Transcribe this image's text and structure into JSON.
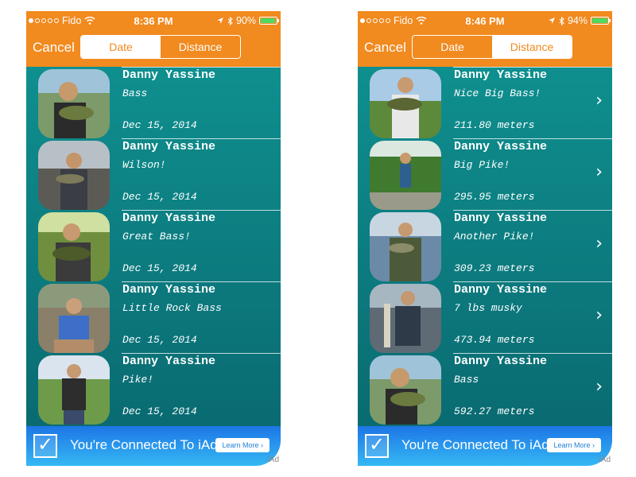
{
  "screens": [
    {
      "status": {
        "carrier": "Fido",
        "time": "8:36 PM",
        "battery": "90%",
        "battery_level": 0.9
      },
      "nav": {
        "cancel": "Cancel",
        "tab_date": "Date",
        "tab_distance": "Distance",
        "selected": "distance"
      },
      "rows": [
        {
          "name": "Danny Yassine",
          "caption": "Bass",
          "meta": "Dec 15, 2014"
        },
        {
          "name": "Danny Yassine",
          "caption": "Wilson!",
          "meta": "Dec 15, 2014"
        },
        {
          "name": "Danny Yassine",
          "caption": "Great Bass!",
          "meta": "Dec 15, 2014"
        },
        {
          "name": "Danny Yassine",
          "caption": "Little Rock Bass",
          "meta": "Dec 15, 2014"
        },
        {
          "name": "Danny Yassine",
          "caption": "Pike!",
          "meta": "Dec 15, 2014"
        }
      ],
      "ad": {
        "text": "You're Connected To iAd",
        "button": "Learn More ›",
        "label": "iAd"
      }
    },
    {
      "status": {
        "carrier": "Fido",
        "time": "8:46 PM",
        "battery": "94%",
        "battery_level": 0.94
      },
      "nav": {
        "cancel": "Cancel",
        "tab_date": "Date",
        "tab_distance": "Distance",
        "selected": "date"
      },
      "rows": [
        {
          "name": "Danny Yassine",
          "caption": "Nice Big Bass!",
          "meta": "211.80 meters"
        },
        {
          "name": "Danny Yassine",
          "caption": "Big Pike!",
          "meta": "295.95 meters"
        },
        {
          "name": "Danny Yassine",
          "caption": "Another Pike!",
          "meta": "309.23 meters"
        },
        {
          "name": "Danny Yassine",
          "caption": "7 lbs musky",
          "meta": "473.94 meters"
        },
        {
          "name": "Danny Yassine",
          "caption": "Bass",
          "meta": "592.27 meters"
        }
      ],
      "ad": {
        "text": "You're Connected To iAd",
        "button": "Learn More ›",
        "label": "iAd"
      }
    }
  ]
}
